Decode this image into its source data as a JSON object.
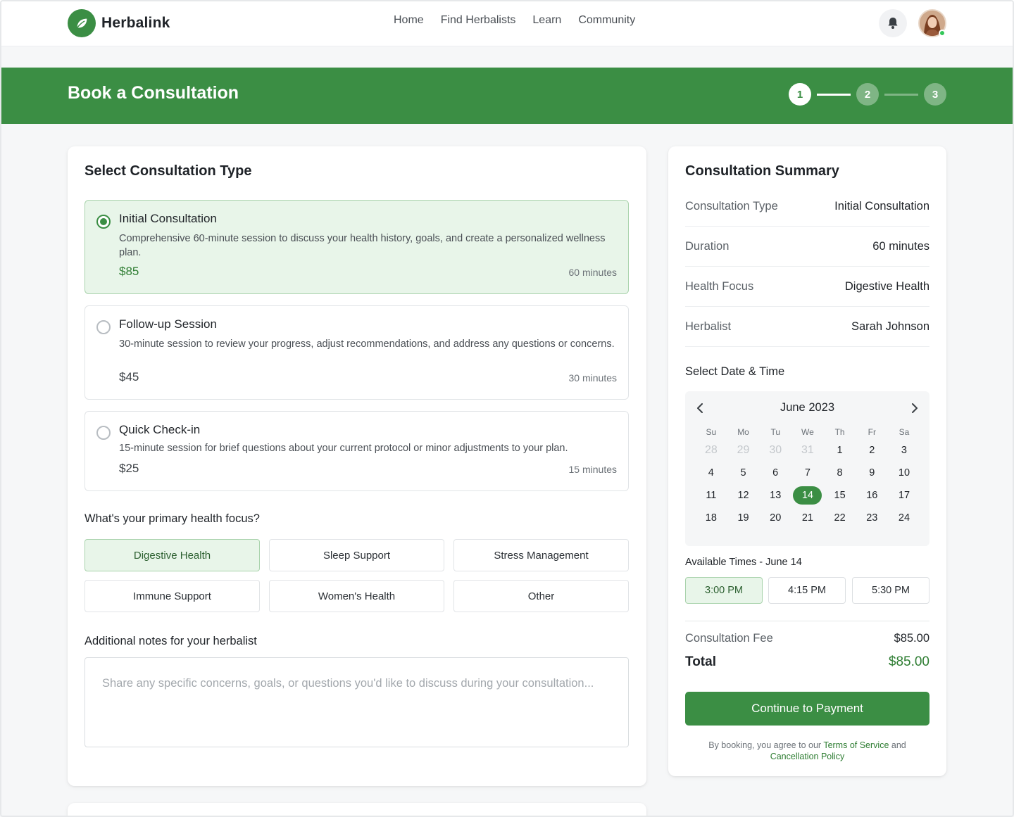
{
  "app": {
    "name": "Herbalink",
    "nav": [
      "Home",
      "Find Herbalists",
      "Learn",
      "Community"
    ]
  },
  "banner": {
    "title": "Book a Consultation",
    "steps": [
      "1",
      "2",
      "3"
    ],
    "current_step": 1
  },
  "consultation": {
    "section_title": "Select Consultation Type",
    "options": [
      {
        "title": "Initial Consultation",
        "description": "Comprehensive 60-minute session to discuss your health history, goals, and create a personalized wellness plan.",
        "price": "$85",
        "duration": "60 minutes",
        "selected": true
      },
      {
        "title": "Follow-up Session",
        "description": "30-minute session to review your progress, adjust recommendations, and address any questions or concerns.",
        "price": "$45",
        "duration": "30 minutes",
        "selected": false
      },
      {
        "title": "Quick Check-in",
        "description": "15-minute session for brief questions about your current protocol or minor adjustments to your plan.",
        "price": "$25",
        "duration": "15 minutes",
        "selected": false
      }
    ]
  },
  "focus": {
    "question": "What's your primary health focus?",
    "options": [
      "Digestive Health",
      "Sleep Support",
      "Stress Management",
      "Immune Support",
      "Women's Health",
      "Other"
    ],
    "selected": "Digestive Health"
  },
  "notes": {
    "label": "Additional notes for your herbalist",
    "placeholder": "Share any specific concerns, goals, or questions you'd like to discuss during your consultation..."
  },
  "summary": {
    "title": "Consultation Summary",
    "rows": [
      {
        "label": "Consultation Type",
        "value": "Initial Consultation"
      },
      {
        "label": "Duration",
        "value": "60 minutes"
      },
      {
        "label": "Health Focus",
        "value": "Digestive Health"
      },
      {
        "label": "Herbalist",
        "value": "Sarah Johnson"
      }
    ],
    "date_time_label": "Select Date & Time",
    "calendar": {
      "month": "June 2023",
      "weekdays": [
        "Su",
        "Mo",
        "Tu",
        "We",
        "Th",
        "Fr",
        "Sa"
      ],
      "weeks": [
        [
          "28",
          "29",
          "30",
          "31",
          "1",
          "2",
          "3"
        ],
        [
          "4",
          "5",
          "6",
          "7",
          "8",
          "9",
          "10"
        ],
        [
          "11",
          "12",
          "13",
          "14",
          "15",
          "16",
          "17"
        ],
        [
          "18",
          "19",
          "20",
          "21",
          "22",
          "23",
          "24"
        ]
      ],
      "muted_days": [
        "28",
        "29",
        "30",
        "31"
      ],
      "selected_day": "14"
    },
    "available_times_label": "Available Times - June 14",
    "times": [
      "3:00 PM",
      "4:15 PM",
      "5:30 PM"
    ],
    "selected_time": "3:00 PM",
    "fee_label": "Consultation Fee",
    "fee_value": "$85.00",
    "total_label": "Total",
    "total_value": "$85.00",
    "cta": "Continue to Payment",
    "terms_prefix": "By booking, you agree to our ",
    "terms_link": "Terms of Service",
    "terms_and": " and ",
    "policy_link": "Cancellation Policy"
  },
  "colors": {
    "brand": "#3b8e44",
    "selected_bg": "#e8f5e9",
    "price_green": "#2e7d32"
  },
  "icons": {
    "logo": "leaf-icon",
    "notifications": "bell-icon",
    "prev_month": "chevron-left-icon",
    "next_month": "chevron-right-icon"
  }
}
